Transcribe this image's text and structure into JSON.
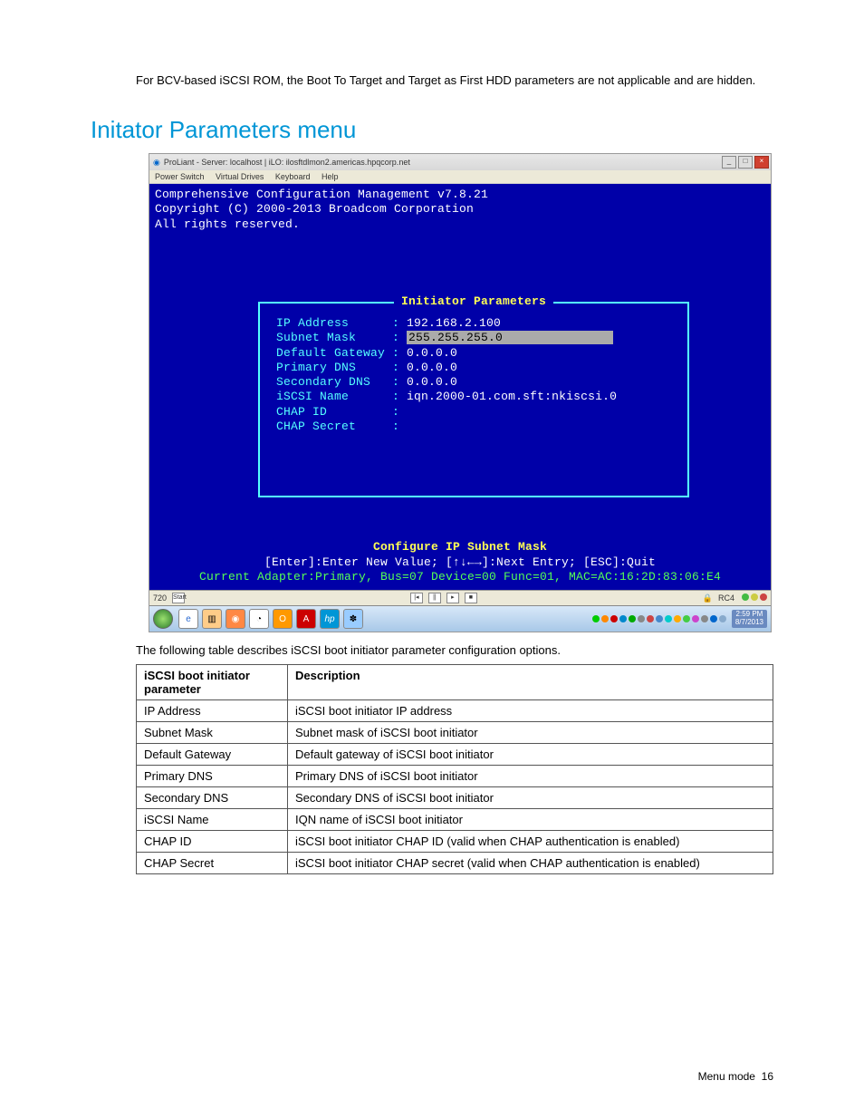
{
  "intro": "For BCV-based iSCSI ROM, the Boot To Target and Target as First HDD parameters are not applicable and are hidden.",
  "heading": "Initator Parameters menu",
  "window": {
    "title": "ProLiant - Server: localhost | iLO: ilosftdlmon2.americas.hpqcorp.net",
    "menus": [
      "Power Switch",
      "Virtual Drives",
      "Keyboard",
      "Help"
    ]
  },
  "terminal": {
    "header1": "Comprehensive Configuration Management v7.8.21",
    "header2": "Copyright (C) 2000-2013 Broadcom Corporation",
    "header3": "All rights reserved.",
    "box_title": "Initiator Parameters",
    "params": [
      {
        "label": "IP Address     ",
        "value": "192.168.2.100",
        "selected": false
      },
      {
        "label": "Subnet Mask    ",
        "value": "255.255.255.0",
        "selected": true
      },
      {
        "label": "Default Gateway",
        "value": "0.0.0.0",
        "selected": false
      },
      {
        "label": "Primary DNS    ",
        "value": "0.0.0.0",
        "selected": false
      },
      {
        "label": "Secondary DNS  ",
        "value": "0.0.0.0",
        "selected": false
      },
      {
        "label": "iSCSI Name     ",
        "value": "iqn.2000-01.com.sft:nkiscsi.0",
        "selected": false
      },
      {
        "label": "CHAP ID        ",
        "value": "",
        "selected": false
      },
      {
        "label": "CHAP Secret    ",
        "value": "",
        "selected": false
      }
    ],
    "hint_title": "Configure IP Subnet Mask",
    "hint_keys": "[Enter]:Enter New Value; [↑↓←→]:Next Entry; [ESC]:Quit",
    "adapter_line": "Current Adapter:Primary, Bus=07 Device=00 Func=01, MAC=AC:16:2D:83:06:E4"
  },
  "statusbar": {
    "res": "720",
    "start": "Start",
    "rc": "RC4"
  },
  "taskbar": {
    "time": "2:59 PM",
    "date": "8/7/2013"
  },
  "after": "The following table describes iSCSI boot initiator parameter configuration options.",
  "table": {
    "head": [
      "iSCSI boot initiator parameter",
      "Description"
    ],
    "rows": [
      [
        "IP Address",
        "iSCSI boot initiator IP address"
      ],
      [
        "Subnet Mask",
        "Subnet mask of iSCSI boot initiator"
      ],
      [
        "Default Gateway",
        "Default gateway of iSCSI boot initiator"
      ],
      [
        "Primary DNS",
        "Primary DNS of iSCSI boot initiator"
      ],
      [
        "Secondary DNS",
        "Secondary DNS of iSCSI boot initiator"
      ],
      [
        "iSCSI Name",
        "IQN name of iSCSI boot initiator"
      ],
      [
        "CHAP ID",
        "iSCSI boot initiator CHAP ID (valid when CHAP authentication is enabled)"
      ],
      [
        "CHAP Secret",
        "iSCSI boot initiator CHAP secret (valid when CHAP authentication is enabled)"
      ]
    ]
  },
  "footer": {
    "label": "Menu mode",
    "page": "16"
  }
}
